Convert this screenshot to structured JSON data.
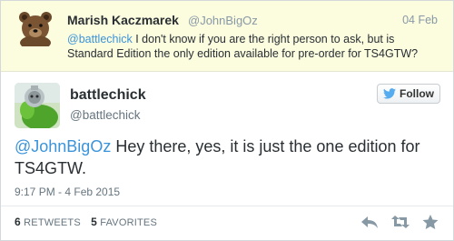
{
  "parent_tweet": {
    "name": "Marish Kaczmarek",
    "handle": "@JohnBigOz",
    "date": "04 Feb",
    "mention": "@battlechick",
    "text": " I don't know if you are the right person to ask, but is Standard Edition the only edition available for pre-order for TS4GTW?"
  },
  "tweet": {
    "name": "battlechick",
    "handle": "@battlechick",
    "follow_label": "Follow",
    "mention": "@JohnBigOz",
    "text": " Hey there, yes, it is just the one edition for TS4GTW.",
    "timestamp": "9:17 PM - 4 Feb 2015",
    "retweets_count": "6",
    "retweets_label": "RETWEETS",
    "favorites_count": "5",
    "favorites_label": "FAVORITES"
  },
  "icons": {
    "parent_avatar": "bear-avatar-icon",
    "main_avatar": "robot-avatar-icon",
    "follow": "twitter-bird-icon",
    "reply": "reply-icon",
    "retweet": "retweet-icon",
    "favorite": "star-icon"
  },
  "colors": {
    "parent_background": "#fcfcdf",
    "mention": "#3b94d9",
    "twitter_blue": "#55acee"
  }
}
